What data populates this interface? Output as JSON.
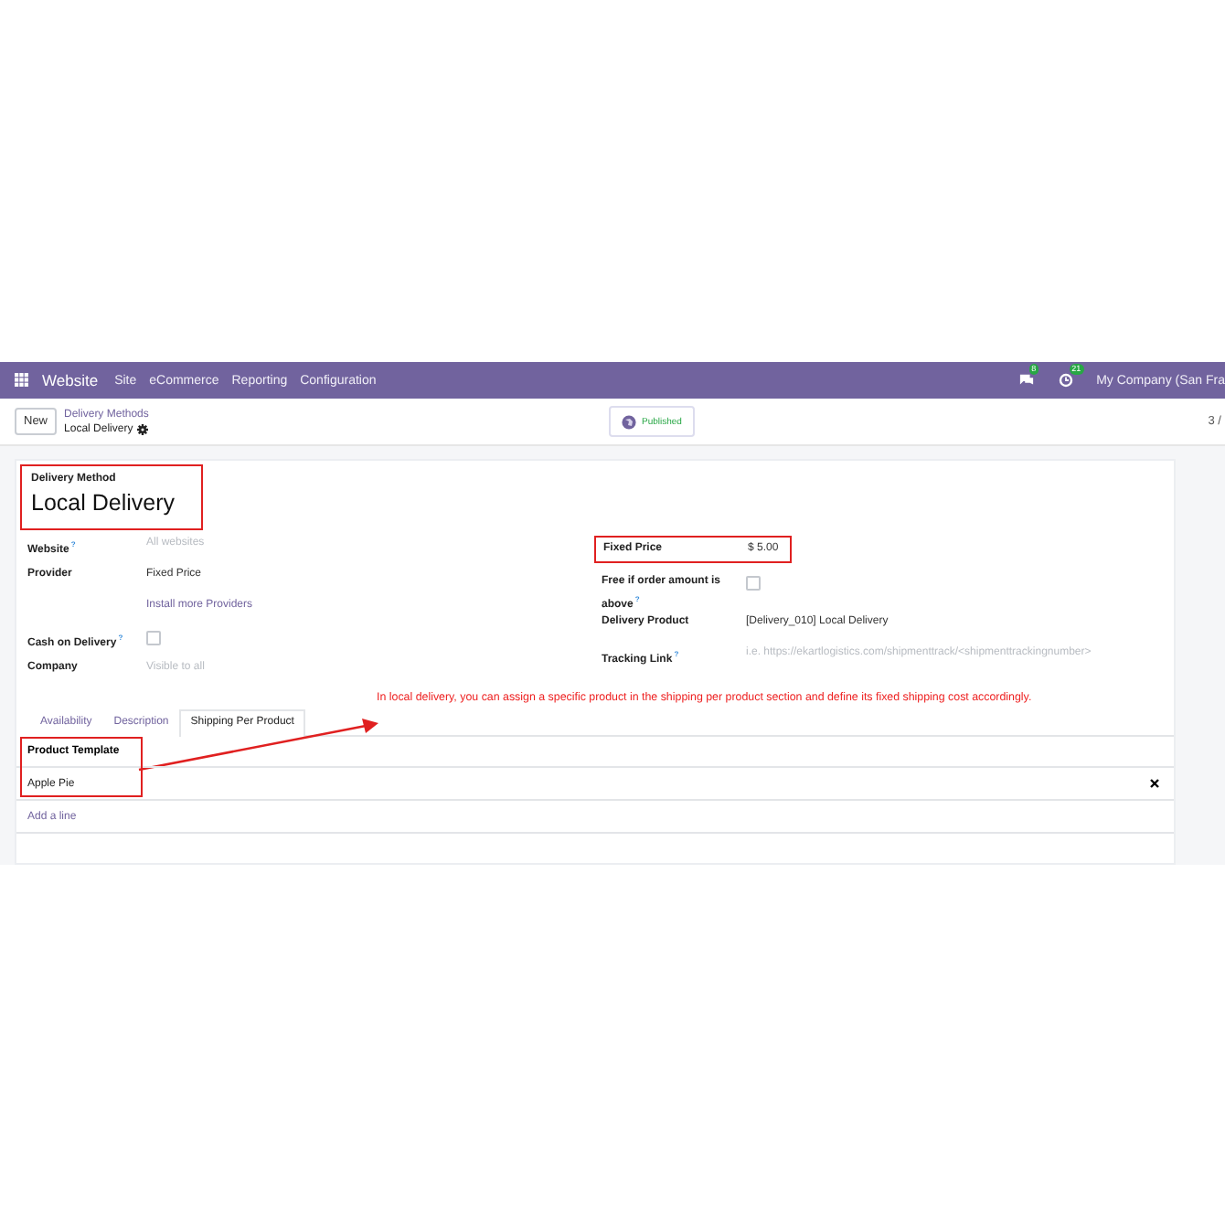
{
  "navbar": {
    "app": "Website",
    "menus": [
      "Site",
      "eCommerce",
      "Reporting",
      "Configuration"
    ],
    "chat_badge": "8",
    "activity_badge": "21",
    "company": "My Company (San Fra"
  },
  "control_panel": {
    "new_button": "New",
    "breadcrumb_parent": "Delivery Methods",
    "breadcrumb_current": "Local Delivery",
    "status": "Published",
    "pager": "3 /"
  },
  "header": {
    "label": "Delivery Method",
    "title": "Local Delivery",
    "highlighted": true
  },
  "left_fields": [
    {
      "kind": "placeholder",
      "label": "Website",
      "help": "?",
      "placeholder": "All websites"
    },
    {
      "kind": "text",
      "label": "Provider",
      "value": "Fixed Price"
    },
    {
      "kind": "link",
      "value": "Install more Providers"
    },
    {
      "kind": "checkbox",
      "label": "Cash on Delivery",
      "help": "?",
      "checked": false
    },
    {
      "kind": "placeholder",
      "label": "Company",
      "placeholder": "Visible to all"
    }
  ],
  "right_fields": [
    {
      "kind": "text",
      "label": "Fixed Price",
      "value": "$ 5.00",
      "highlighted": true
    },
    {
      "kind": "checkbox",
      "label": "Free if order amount is above",
      "help": "?",
      "checked": false
    },
    {
      "kind": "text",
      "label": "Delivery Product",
      "value": "[Delivery_010] Local Delivery"
    },
    {
      "kind": "placeholder",
      "label": "Tracking Link",
      "help": "?",
      "placeholder": "i.e. https://ekartlogistics.com/shipmenttrack/<shipmenttrackingnumber>"
    }
  ],
  "tabs": [
    {
      "label": "Availability",
      "selected": false
    },
    {
      "label": "Description",
      "selected": false
    },
    {
      "label": "Shipping Per Product",
      "selected": true
    }
  ],
  "annotation": "In local delivery, you can assign a specific product in the shipping per product section and define its fixed shipping cost accordingly.",
  "table": {
    "column": "Product Template",
    "highlighted": true,
    "rows": [
      "Apple Pie"
    ],
    "add_line": "Add a line"
  }
}
